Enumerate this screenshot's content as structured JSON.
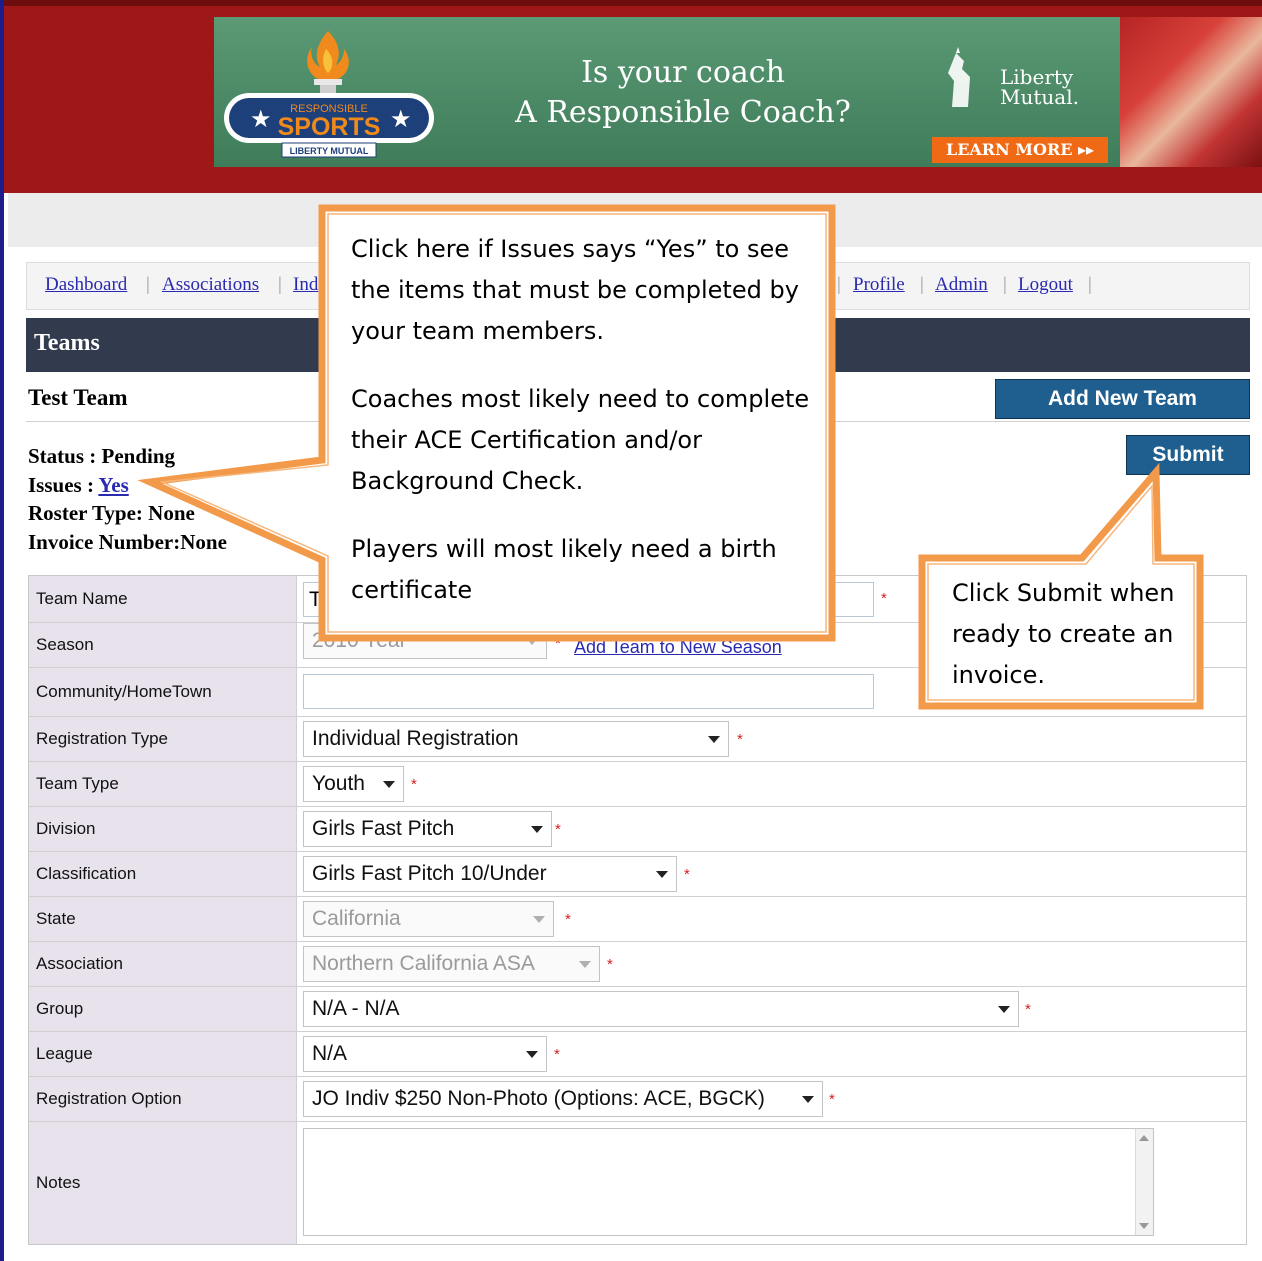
{
  "ad": {
    "logo_top": "RESPONSIBLE",
    "logo_main": "SPORTS",
    "logo_sub": "LIBERTY MUTUAL",
    "headline_line1": "Is your coach",
    "headline_line2": "A Responsible Coach?",
    "sponsor_line1": "Liberty",
    "sponsor_line2": "Mutual.",
    "cta": "LEARN MORE ▸▸"
  },
  "nav": {
    "items": [
      "Dashboard",
      "Associations",
      "Ind",
      "Profile",
      "Admin",
      "Logout"
    ]
  },
  "section_title": "Teams",
  "team_name_heading": "Test Team",
  "buttons": {
    "add_new_team": "Add New Team",
    "submit": "Submit"
  },
  "status": {
    "status_label": "Status : ",
    "status_value": "Pending",
    "issues_label": "Issues : ",
    "issues_value": "Yes",
    "roster_label": "Roster Type: ",
    "roster_value": "None",
    "invoice_label": "Invoice Number:",
    "invoice_value": "None"
  },
  "form": {
    "team_name": {
      "label": "Team Name",
      "value": "T"
    },
    "season": {
      "label": "Season",
      "value": "2010 Year",
      "link": "Add Team to New Season"
    },
    "community": {
      "label": "Community/HomeTown",
      "value": ""
    },
    "registration_type": {
      "label": "Registration Type",
      "value": "Individual Registration"
    },
    "team_type": {
      "label": "Team Type",
      "value": "Youth"
    },
    "division": {
      "label": "Division",
      "value": "Girls Fast Pitch"
    },
    "classification": {
      "label": "Classification",
      "value": "Girls Fast Pitch 10/Under"
    },
    "state": {
      "label": "State",
      "value": "California"
    },
    "association": {
      "label": "Association",
      "value": "Northern California ASA"
    },
    "group": {
      "label": "Group",
      "value": "N/A - N/A"
    },
    "league": {
      "label": "League",
      "value": "N/A"
    },
    "registration_option": {
      "label": "Registration Option",
      "value": "JO Indiv $250 Non-Photo (Options: ACE, BGCK)"
    },
    "notes": {
      "label": "Notes",
      "value": ""
    },
    "required_mark": "*"
  },
  "callouts": {
    "issues": {
      "p1": "Click here if Issues says “Yes” to see the items that must be completed by your team members.",
      "p2": "Coaches most likely need to complete their ACE Certification and/or Background Check.",
      "p3": "Players will most likely need a birth certificate"
    },
    "submit": {
      "text": "Click Submit when ready to create an invoice."
    }
  },
  "colors": {
    "banner_red": "#9e1818",
    "nav_link": "#2a2ab0",
    "teams_bar": "#323a4e",
    "button_blue": "#1f5f8f",
    "label_bg": "#e7e2ec",
    "callout_orange": "#f39a4a",
    "required_red": "#d62020"
  }
}
